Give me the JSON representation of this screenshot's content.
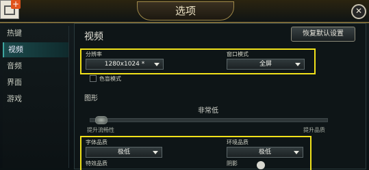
{
  "window": {
    "title": "选项"
  },
  "sidebar": {
    "items": [
      {
        "label": "热键"
      },
      {
        "label": "视频",
        "active": true
      },
      {
        "label": "音频"
      },
      {
        "label": "界面"
      },
      {
        "label": "游戏"
      }
    ]
  },
  "video": {
    "title": "视频",
    "reset_label": "恢复默认设置",
    "resolution": {
      "label": "分辨率",
      "value": "1280x1024 *"
    },
    "window_mode": {
      "label": "窗口模式",
      "value": "全屏"
    },
    "colorblind": {
      "label": "色盲模式",
      "checked": false
    }
  },
  "graphics": {
    "title": "图形",
    "overall_quality": "非常低",
    "slider_left_label": "提升流畅性",
    "slider_right_label": "提升品质",
    "character_quality": {
      "label": "字体品质",
      "value": "极低"
    },
    "environment_quality": {
      "label": "环境品质",
      "value": "极低"
    },
    "effects_quality": {
      "label": "特效品质"
    },
    "shadows": {
      "label": "阴影"
    }
  },
  "colors": {
    "highlight_box": "#f2e21a",
    "active_tab": "#1b4a4c",
    "brand_orange": "#e0531c"
  },
  "icons": {
    "app_logo": "add-window-icon",
    "close": "close-icon",
    "dropdown": "chevron-down-icon"
  }
}
